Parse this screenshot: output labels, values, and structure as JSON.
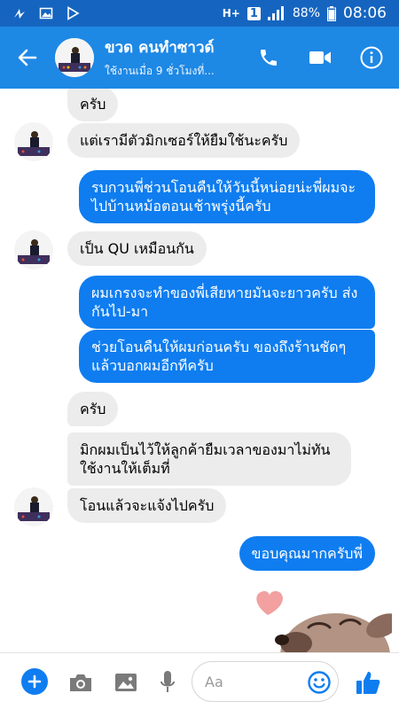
{
  "status_bar": {
    "network": "H+",
    "sim": "1",
    "battery": "88%",
    "time": "08:06"
  },
  "header": {
    "contact_name": "ขวด คนทำซาวด์",
    "contact_status": "ใช้งานเมื่อ 9 ชั่วโมงที่...",
    "icons": [
      "back-arrow-icon",
      "phone-icon",
      "video-camera-icon",
      "info-icon"
    ]
  },
  "messages": [
    {
      "side": "in",
      "text": "ครับ"
    },
    {
      "side": "in",
      "text": "แต่เรามีตัวมิกเซอร์ให้ยืมใช้นะครับ"
    },
    {
      "side": "out",
      "text": "รบกวนพี่ช่วนโอนคืนให้วันนี้หน่อยน่ะพี่ผมจะไปบ้านหม้อตอนเช้าพรุ่งนี้ครับ"
    },
    {
      "side": "in",
      "text": "เป็น QU เหมือนกัน"
    },
    {
      "side": "out",
      "text": "ผมเกรงจะทำของพี่เสียหายมันจะยาวครับ ส่งกันไป-มา"
    },
    {
      "side": "out",
      "text": "ช่วยโอนคืนให้ผมก่อนครับ ของถึงร้านชัดๆ แล้วบอกผมอีกทีครับ"
    },
    {
      "side": "in",
      "text": "ครับ"
    },
    {
      "side": "in",
      "text": "มิกผมเป็นไว้ให้ลูกค้ายืมเวลาของมาไม่ทัน ใช้งานให้เต็มที่"
    },
    {
      "side": "in",
      "text": "โอนแล้วจะแจ้งไปครับ"
    },
    {
      "side": "out",
      "text": "ขอบคุณมากครับพี่"
    }
  ],
  "composer": {
    "placeholder": "Aa",
    "icons": [
      "plus-icon",
      "camera-icon",
      "gallery-icon",
      "microphone-icon",
      "emoji-icon",
      "thumbs-up-icon"
    ]
  },
  "colors": {
    "status_bar": "#1565c0",
    "header": "#1e88e5",
    "outgoing_bubble": "#0f7df0",
    "incoming_bubble": "#ececec"
  }
}
